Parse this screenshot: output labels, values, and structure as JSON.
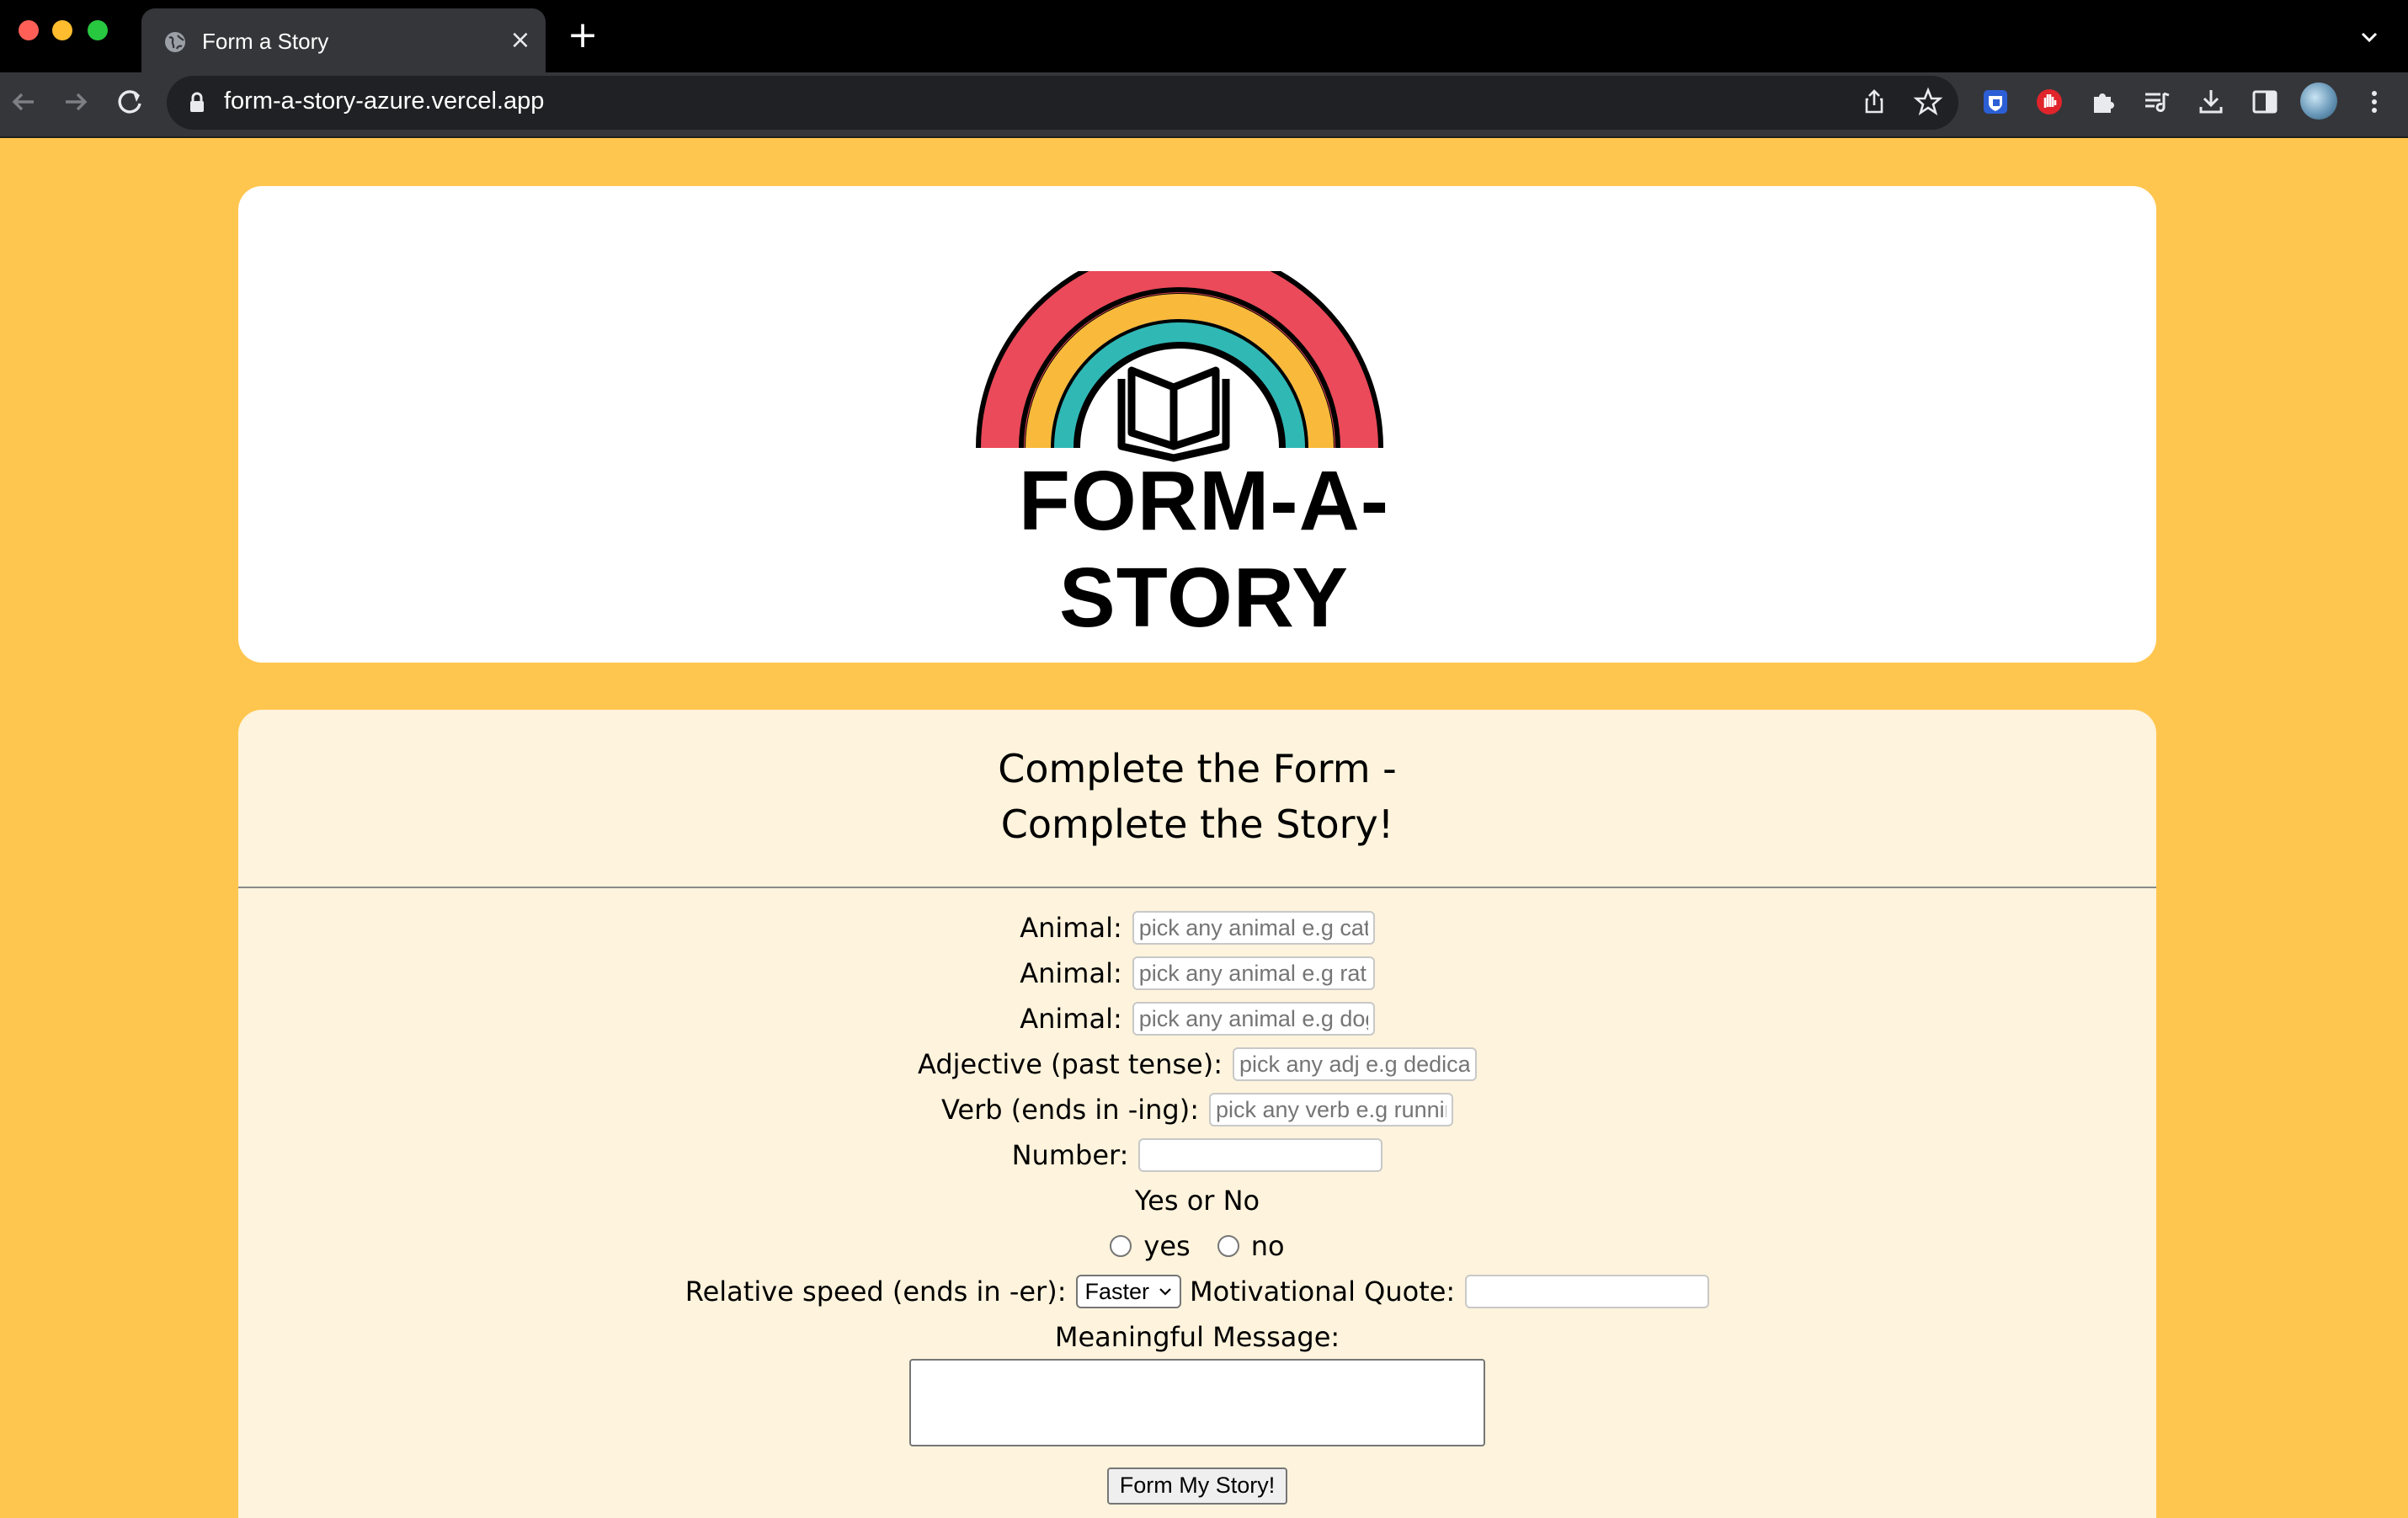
{
  "browser": {
    "tab_title": "Form a Story",
    "url": "form-a-story-azure.vercel.app",
    "new_tab_glyph": "+",
    "close_glyph": "×"
  },
  "header": {
    "logo_text": "FORM-A-STORY",
    "logo_colors": {
      "outer": "#ea4a5a",
      "middle": "#f9b93a",
      "inner": "#30b8b5",
      "outline": "#000000"
    }
  },
  "form": {
    "title_line1": "Complete the Form -",
    "title_line2": "Complete the Story!",
    "fields": [
      {
        "label": "Animal:",
        "value": "",
        "placeholder": "pick any animal e.g cat"
      },
      {
        "label": "Animal:",
        "value": "",
        "placeholder": "pick any animal e.g rat"
      },
      {
        "label": "Animal:",
        "value": "",
        "placeholder": "pick any animal e.g dog"
      },
      {
        "label": "Adjective (past tense):",
        "value": "",
        "placeholder": "pick any adj e.g dedicat"
      },
      {
        "label": "Verb (ends in -ing):",
        "value": "",
        "placeholder": "pick any verb e.g runnir"
      },
      {
        "label": "Number:",
        "value": "",
        "placeholder": ""
      }
    ],
    "yes_no": {
      "label": "Yes or No",
      "options": [
        "yes",
        "no"
      ]
    },
    "speed": {
      "label": "Relative speed (ends in -er):",
      "selected": "Faster"
    },
    "quote": {
      "label": "Motivational Quote:",
      "value": "",
      "placeholder": ""
    },
    "message": {
      "label": "Meaningful Message:",
      "value": ""
    },
    "submit_label": "Form My Story!"
  },
  "colors": {
    "page_bg": "#ffc64f",
    "form_bg": "#fef3dc",
    "header_bg": "#ffffff"
  }
}
